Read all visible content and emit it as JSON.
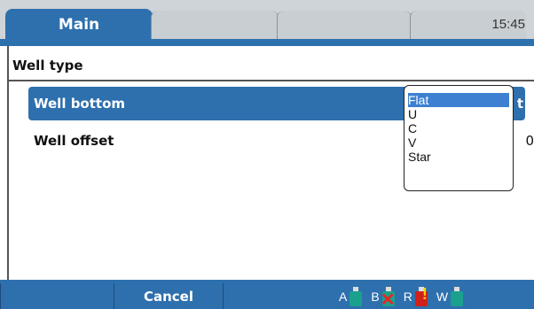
{
  "header": {
    "tabs": [
      {
        "label": "Main",
        "active": true
      },
      {
        "label": "",
        "active": false
      },
      {
        "label": "",
        "active": false
      },
      {
        "label": "",
        "active": false
      }
    ],
    "clock": "15:45"
  },
  "section": {
    "title": "Well type",
    "rows": [
      {
        "label": "Well bottom",
        "value": "t",
        "selected": true
      },
      {
        "label": "Well offset",
        "value": "0",
        "selected": false
      }
    ]
  },
  "dropdown": {
    "options": [
      "Flat",
      "U",
      "C",
      "V",
      "Star"
    ],
    "selected": "Flat"
  },
  "footer": {
    "buttons": [
      "",
      "Cancel",
      ""
    ],
    "reservoirs": [
      {
        "letter": "A",
        "status": "ok",
        "color": "#1aa08c",
        "icon": "bottle-icon"
      },
      {
        "letter": "B",
        "status": "error",
        "color": "#1aa08c",
        "icon": "bottle-error-icon"
      },
      {
        "letter": "R",
        "status": "warning",
        "color": "#d0201a",
        "icon": "bottle-warning-icon"
      },
      {
        "letter": "W",
        "status": "ok",
        "color": "#1aa08c",
        "icon": "bottle-icon"
      }
    ]
  },
  "colors": {
    "accent": "#2e6fae",
    "selection": "#3d7fd1",
    "tab_inactive": "#cfd4d8"
  }
}
